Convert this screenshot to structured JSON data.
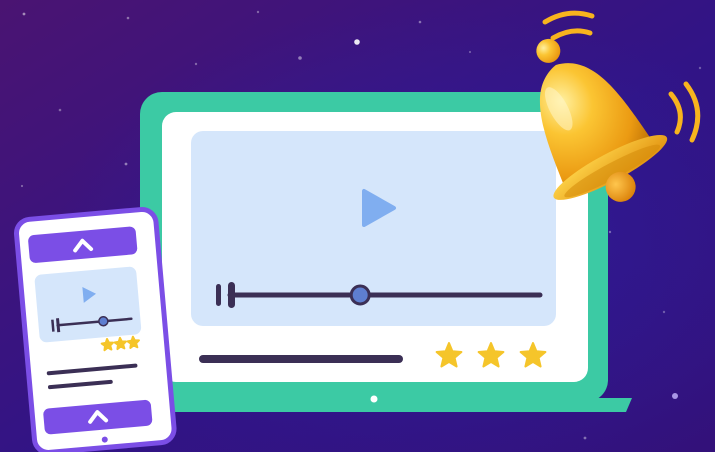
{
  "scene": {
    "background": {
      "top_left": "#4a1472",
      "bottom_right": "#33117a",
      "center": "#2d1a8a"
    },
    "laptop": {
      "frame_color": "#3ccaa4",
      "screen_color": "#ffffff",
      "player_color": "#d5e6fb",
      "play_icon": "play-icon",
      "play_color": "#80aef0",
      "track_color": "#3b2f55",
      "knob_color": "#5e7ed0",
      "progress": 0.42,
      "bar_color": "#3b2f55",
      "rating": 3,
      "star_color": "#f5c52a"
    },
    "phone": {
      "frame_color": "#7b4ee6",
      "header_icon": "chevron-up-icon",
      "footer_icon": "chevron-up-icon",
      "progress": 0.62,
      "rating": 3
    },
    "bell": {
      "icon": "bell-icon",
      "colors": {
        "light": "#ffd55a",
        "mid": "#f8b41e",
        "dark": "#d98a0c"
      },
      "ringing": true
    }
  }
}
